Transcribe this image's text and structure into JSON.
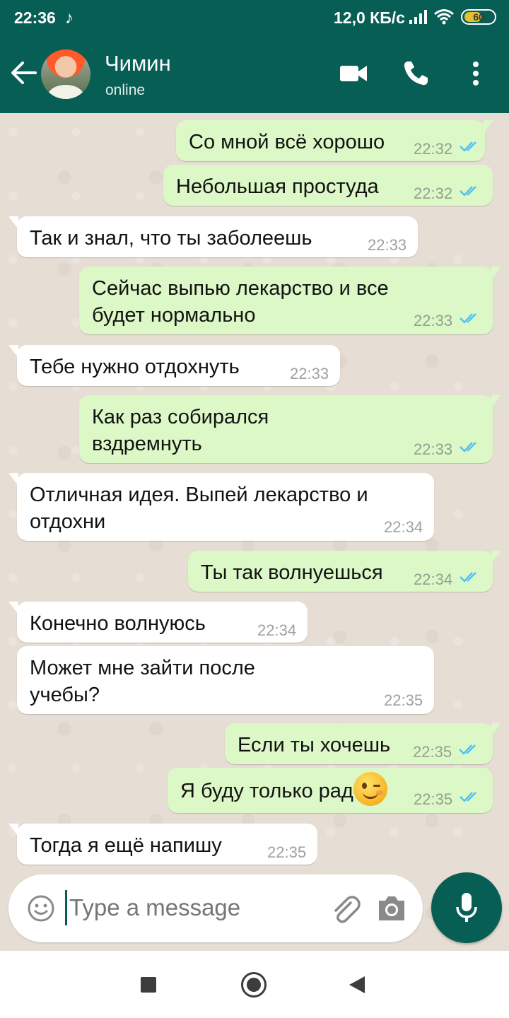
{
  "status_bar": {
    "time": "22:36",
    "net_speed": "12,0 КБ/с",
    "battery_level": "60",
    "battery_fraction": 0.6,
    "tiktok_glyph": "♪"
  },
  "header": {
    "contact_name": "Чимин",
    "contact_status": "online"
  },
  "messages": [
    {
      "dir": "out",
      "text": "Со мной всё хорошо",
      "time": "22:32",
      "read": true
    },
    {
      "dir": "out",
      "text": "Небольшая простуда",
      "time": "22:32",
      "read": true
    },
    {
      "dir": "in",
      "text": "Так и знал, что ты заболеешь",
      "time": "22:33"
    },
    {
      "dir": "out",
      "text": "Сейчас выпью лекарство и все будет нормально",
      "time": "22:33",
      "read": true
    },
    {
      "dir": "in",
      "text": "Тебе нужно отдохнуть",
      "time": "22:33"
    },
    {
      "dir": "out",
      "text": "Как раз собирался вздремнуть",
      "time": "22:33",
      "read": true
    },
    {
      "dir": "in",
      "text": "Отличная идея. Выпей лекарство и отдохни",
      "time": "22:34"
    },
    {
      "dir": "out",
      "text": "Ты так волнуешься",
      "time": "22:34",
      "read": true
    },
    {
      "dir": "in",
      "text": "Конечно волнуюсь",
      "time": "22:34"
    },
    {
      "dir": "in",
      "text": "Может мне зайти после учебы?",
      "time": "22:35"
    },
    {
      "dir": "out",
      "text": "Если ты хочешь",
      "time": "22:35",
      "read": true
    },
    {
      "dir": "out",
      "text": "Я буду только рад",
      "emoji": "winking-face",
      "time": "22:35",
      "read": true
    },
    {
      "dir": "in",
      "text": "Тогда я ещё напишу",
      "time": "22:35"
    }
  ],
  "composer": {
    "placeholder": "Type a message"
  },
  "colors": {
    "header_bg": "#075e54",
    "outgoing_bubble": "#dcf8c6",
    "incoming_bubble": "#ffffff",
    "read_ticks": "#4fc3f7",
    "chat_bg": "#e6ddd4"
  },
  "icons": {
    "back": "arrow-left-icon",
    "video": "video-call-icon",
    "call": "phone-icon",
    "menu": "more-vertical-icon",
    "emoji": "smiley-icon",
    "attach": "paperclip-icon",
    "camera": "camera-icon",
    "mic": "microphone-icon"
  }
}
